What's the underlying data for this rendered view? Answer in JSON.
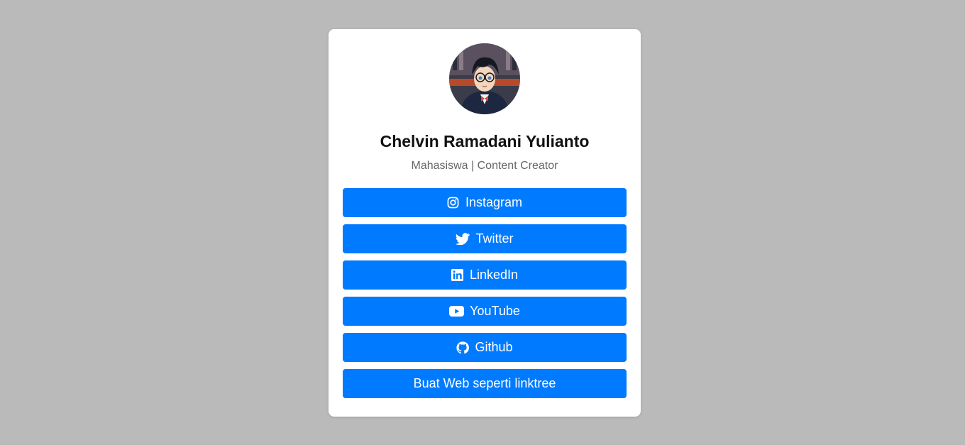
{
  "profile": {
    "name": "Chelvin Ramadani Yulianto",
    "subtitle": "Mahasiswa | Content Creator"
  },
  "links": [
    {
      "label": "Instagram",
      "icon": "instagram-icon"
    },
    {
      "label": "Twitter",
      "icon": "twitter-icon"
    },
    {
      "label": "LinkedIn",
      "icon": "linkedin-icon"
    },
    {
      "label": "YouTube",
      "icon": "youtube-icon"
    },
    {
      "label": "Github",
      "icon": "github-icon"
    },
    {
      "label": "Buat Web seperti linktree",
      "icon": ""
    }
  ],
  "colors": {
    "background": "#bababa",
    "card": "#ffffff",
    "button": "#007bff",
    "button_text": "#ffffff",
    "name_text": "#111111",
    "subtitle_text": "#666666"
  }
}
